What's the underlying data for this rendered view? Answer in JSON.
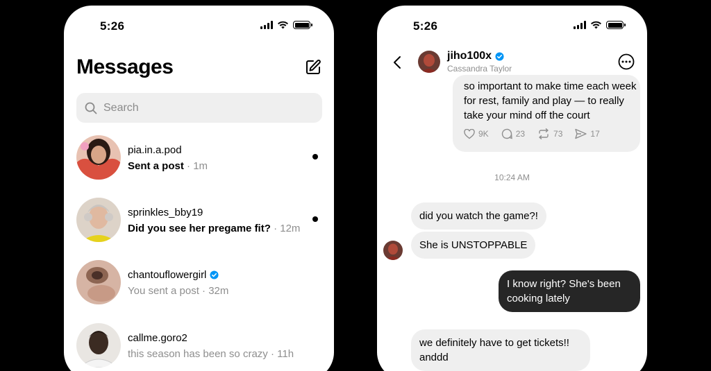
{
  "left_phone": {
    "status": {
      "time": "5:26"
    },
    "title": "Messages",
    "search": {
      "placeholder": "Search"
    },
    "threads": [
      {
        "username": "pia.in.a.pod",
        "preview": "Sent a post",
        "time": "· 1m",
        "unread": true,
        "verified": false,
        "avatar_color": "#d9503f"
      },
      {
        "username": "sprinkles_bby19",
        "preview": "Did you see her pregame fit?",
        "time": "· 12m",
        "unread": true,
        "verified": false,
        "avatar_color": "#c8b8a8"
      },
      {
        "username": "chantouflowergirl",
        "preview": "You sent a post",
        "time": "· 32m",
        "unread": false,
        "verified": true,
        "avatar_color": "#a47a63"
      },
      {
        "username": "callme.goro2",
        "preview": "this season has been so crazy",
        "time": "· 11h",
        "unread": false,
        "verified": false,
        "avatar_color": "#3b2b22"
      }
    ]
  },
  "right_phone": {
    "status": {
      "time": "5:26"
    },
    "header": {
      "name": "jiho100x",
      "subtitle": "Cassandra Taylor",
      "verified": true
    },
    "shared_post": {
      "text": "so important to make time each week for rest, family and play — to really take your mind off the court",
      "stats": {
        "likes": "9K",
        "comments": "23",
        "reposts": "73",
        "shares": "17"
      }
    },
    "time_divider": "10:24 AM",
    "messages": [
      {
        "direction": "in",
        "text": "did you watch the game?!"
      },
      {
        "direction": "in",
        "text": "She is UNSTOPPABLE"
      },
      {
        "direction": "out",
        "text": "I know right? She's been cooking lately"
      },
      {
        "direction": "in",
        "text": "we definitely have to get tickets!! anddd"
      }
    ]
  },
  "colors": {
    "background": "#000000",
    "bubble_in": "#efefef",
    "bubble_out": "#262626",
    "verified_blue": "#0095f6",
    "muted_text": "#8e8e8e"
  }
}
